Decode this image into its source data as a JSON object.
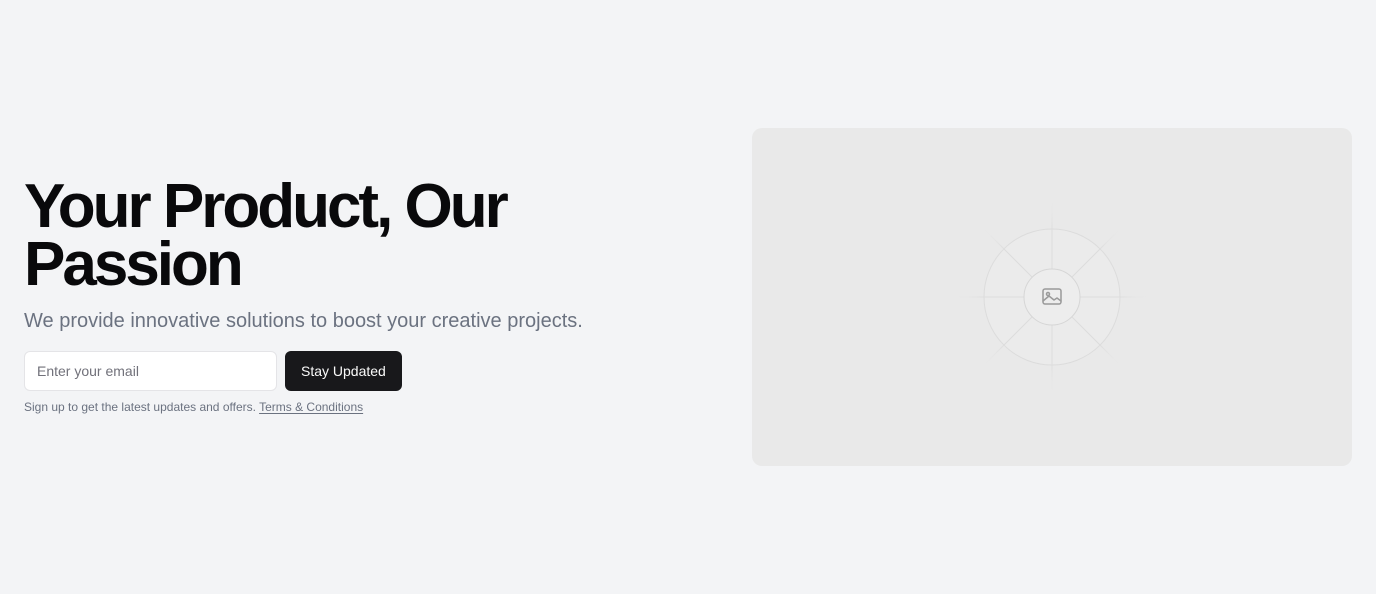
{
  "hero": {
    "headline": "Your Product, Our Passion",
    "subtitle": "We provide innovative solutions to boost your creative projects."
  },
  "signup": {
    "email_placeholder": "Enter your email",
    "button_label": "Stay Updated",
    "note_text": "Sign up to get the latest updates and offers.",
    "terms_link": "Terms & Conditions"
  },
  "media": {
    "icon": "image-icon"
  },
  "colors": {
    "background": "#f3f4f6",
    "headline": "#09090b",
    "muted_text": "#6b7280",
    "button_bg": "#18181b",
    "button_text": "#fafafa",
    "placeholder_bg": "#e9e9e9"
  }
}
